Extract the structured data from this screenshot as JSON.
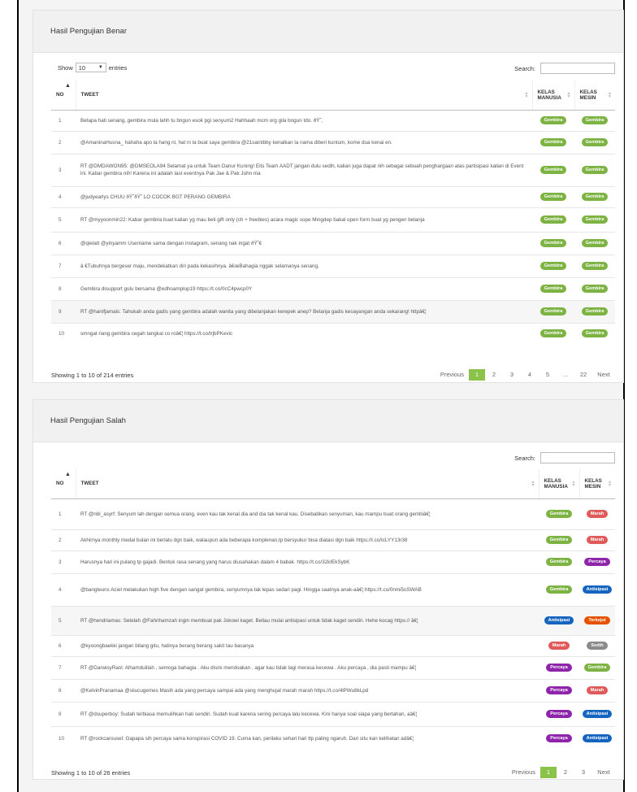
{
  "panel_correct": {
    "title": "Hasil Pengujian Benar",
    "show_label": "Show",
    "entries_value": "10",
    "entries_label": "entries",
    "search_label": "Search:",
    "columns": {
      "no": "NO",
      "tweet": "TWEET",
      "manusia_1": "KELAS",
      "manusia_2": "MANUSIA",
      "mesin_1": "KELAS",
      "mesin_2": "MESIN"
    },
    "rows": [
      {
        "no": "1",
        "tweet": "Betapa hati senang, gembira mula lahh tu bngun esok pgi senyum2 Hahhaah mcm org gila bngun tdo. ðŸ˜‚",
        "manusia": "Gembira",
        "mesin": "Gembira"
      },
      {
        "no": "2",
        "tweet": "@AmaninaHusna_ hahaha apo la hang ni, hat ni la buat saya gembira @21saintbby kenalkan la nama diberi kuntum, kome dua kenai en.",
        "manusia": "Gembira",
        "mesin": "Gembira"
      },
      {
        "no": "3",
        "tweet": "RT @DMDAWON95: @DMSEOLA94 Selamat ya untuk Team Danur Kuning! Eits Team AADT jangan dulu sedih, kalian juga dapat nih sebagai sebuah penghargaan atas partisipasi kalian di Event ini. Kabar gembira nih! Karena ini adalah last eventnya Pak Jae & Pak John ma",
        "manusia": "Gembira",
        "mesin": "Gembira"
      },
      {
        "no": "4",
        "tweet": "@judyearlys CHUU ðŸ˜­ðŸ˜­ LO COCOK BGT PERANG GEMBIRA",
        "manusia": "Gembira",
        "mesin": "Gembira"
      },
      {
        "no": "5",
        "tweet": "RT @myyoonmin22: Kabar gembira buat kalian yg mau beli gift only (ch + freebies) acara magic sope Mingdep bakal open form buat yg pengen belanja",
        "manusia": "Gembira",
        "mesin": "Gembira"
      },
      {
        "no": "6",
        "tweet": "@qielatt @yinyamm Username sama dengan instagram, senang nak ingat ðŸ˜€",
        "manusia": "Gembira",
        "mesin": "Gembira"
      },
      {
        "no": "7",
        "tweet": "â €Tubuhnya bergeser maju, mendekatkan diri pada kekasihnya. â€œBahagia nggak selamanya senang,",
        "manusia": "Gembira",
        "mesin": "Gembira"
      },
      {
        "no": "8",
        "tweet": "Gembira disupport gulu bersama @edhoamplop19 https://t.co/0cC4pwcp0Y",
        "manusia": "Gembira",
        "mesin": "Gembira"
      },
      {
        "no": "9",
        "tweet": "RT @hanifjamals: Tahukah anda gadis yang gembira adalah wanita yang dibelanjakan kerepek anep? Belanja gadis kesayangan anda sekarang! httpâ€¦",
        "manusia": "Gembira",
        "mesin": "Gembira"
      },
      {
        "no": "10",
        "tweet": "smngat riang gembira cegah tangkal co roâ€¦ https://t.co/trjbPKevic",
        "manusia": "Gembira",
        "mesin": "Gembira"
      }
    ],
    "info": "Showing 1 to 10 of 214 entries",
    "pager": {
      "prev": "Previous",
      "p1": "1",
      "p2": "2",
      "p3": "3",
      "p4": "4",
      "p5": "5",
      "ellipsis": "...",
      "p22": "22",
      "next": "Next"
    }
  },
  "panel_wrong": {
    "title": "Hasil Pengujian Salah",
    "search_label": "Search:",
    "columns": {
      "no": "NO",
      "tweet": "TWEET",
      "manusia_1": "KELAS",
      "manusia_2": "MANUSIA",
      "mesin_1": "KELAS",
      "mesin_2": "MESIN"
    },
    "rows": [
      {
        "no": "1",
        "tweet": "RT @nbl_asyrf: Senyum lah dengan semua orang, even kau tak kenal dia and dia tak kenal kau. Disebabkan senyuman, kau mampu buat orang gembiâ€¦",
        "manusia": "Gembira",
        "mesin": "Marah"
      },
      {
        "no": "2",
        "tweet": "Akhirnya monthly medal bulan ini berlalu dgn baik, walaupun ada beberapa komplenan,tp bersyukur bisa diatasi dgn baik https://t.co/IcLYY13r38",
        "manusia": "Gembira",
        "mesin": "Marah"
      },
      {
        "no": "3",
        "tweet": "Harusnya hari ini pulang tp gajadi. Bentuk rasa senang yang harus diusahakan dalam 4 babak. https://t.co/32kIEkSybK",
        "manusia": "Gembira",
        "mesin": "Percaya"
      },
      {
        "no": "4",
        "tweet": "@bangteuns Aciel melakukan high five dengan sangat gembira, senyumnya tak lepas sedari pagi. Hingga saatnya anak-aâ€¦ https://t.co/0nmi5oSWAB",
        "manusia": "Gembira",
        "mesin": "Antisipasi"
      },
      {
        "no": "5",
        "tweet": "RT @hendriamas: Setelah @Fahrihamzah ingin membuat pak Jokowi kaget. Beliau mulai antisipasi untuk tidak kaget sendiri. Hehe kocag https:// â€¦",
        "manusia": "Antisipasi",
        "mesin": "Terkejut"
      },
      {
        "no": "6",
        "tweet": "@kyoongbaekki jangan bilang gitu, hatinya berang berang sakit tau bacanya",
        "manusia": "Marah",
        "mesin": "Sedih"
      },
      {
        "no": "7",
        "tweet": "RT @DarwisyRani: Alhamdulilah , semoga bahagia . Aku disini mendoakan , agar kau tidak lagi merasa kecewa . Aku percaya , dia pasti mampu â€¦",
        "manusia": "Percaya",
        "mesin": "Gembira"
      },
      {
        "no": "8",
        "tweet": "@KelvinPranamaa @siiucugemes Masih ada yang percaya sampai ada yang menghujat marah marah https://t.co/4lPWu8kLpd",
        "manusia": "Percaya",
        "mesin": "Marah"
      },
      {
        "no": "9",
        "tweet": "RT @dsuperboy: Sudah terbiasa memulihkan hati sendiri. Sudah kuat karena sering percaya lalu kecewa. Kini hanya soal siapa yang bertahan, aâ€¦",
        "manusia": "Percaya",
        "mesin": "Antisipasi"
      },
      {
        "no": "10",
        "tweet": "RT @rockcarousel: Gapapa sih percaya sama konspirasi COVID 19. Cuma kan, perilaku sehari hari ttp paling ngaruh. Dari situ kan kelihatan adâ€¦",
        "manusia": "Percaya",
        "mesin": "Antisipasi"
      }
    ],
    "info": "Showing 1 to 10 of 26 entries",
    "pager": {
      "prev": "Previous",
      "p1": "1",
      "p2": "2",
      "p3": "3",
      "next": "Next"
    }
  },
  "badge_colors": {
    "Gembira": "#7cb342",
    "Marah": "#e05a5a",
    "Percaya": "#8e24aa",
    "Antisipasi": "#1565c0",
    "Terkejut": "#e65100",
    "Sedih": "#8a8a8a"
  },
  "icons": {
    "sort": "sort-arrows-icon",
    "sort_asc": "sort-asc-icon",
    "caret": "caret-down-icon"
  }
}
